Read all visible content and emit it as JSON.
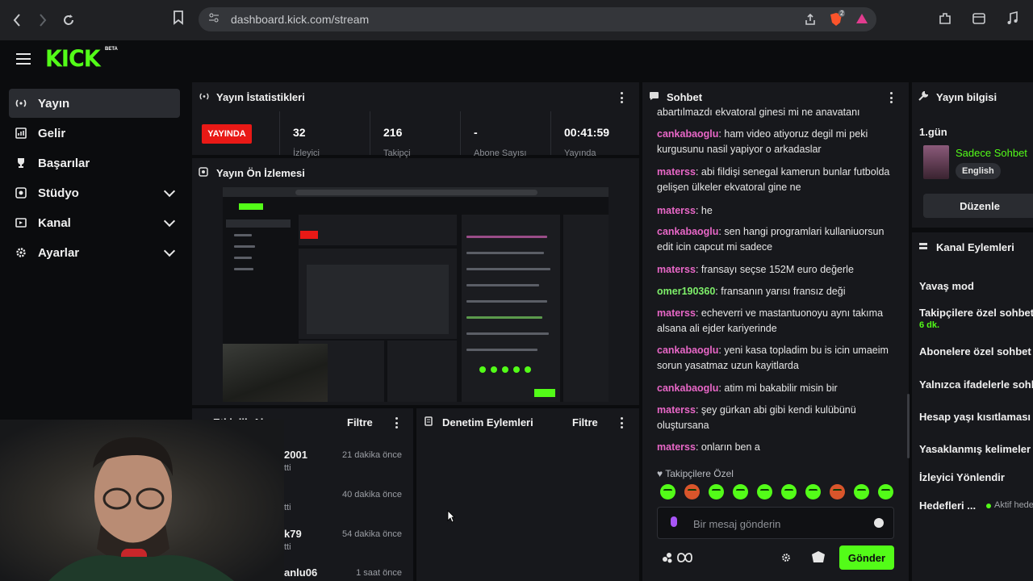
{
  "browser": {
    "url": "dashboard.kick.com/stream",
    "ext_badge": "2"
  },
  "brand": {
    "logo": "KICK",
    "beta": "BETA",
    "accent": "#53fc18"
  },
  "sidebar": {
    "items": [
      {
        "label": "Yayın",
        "icon": "broadcast-icon",
        "active": true
      },
      {
        "label": "Gelir",
        "icon": "revenue-icon"
      },
      {
        "label": "Başarılar",
        "icon": "trophy-icon"
      },
      {
        "label": "Stüdyo",
        "icon": "studio-icon",
        "expandable": true
      },
      {
        "label": "Kanal",
        "icon": "channel-icon",
        "expandable": true
      },
      {
        "label": "Ayarlar",
        "icon": "gear-icon",
        "expandable": true
      }
    ]
  },
  "stats": {
    "title": "Yayın İstatistikleri",
    "live": "YAYINDA",
    "columns": [
      {
        "value": "32",
        "label": "İzleyici"
      },
      {
        "value": "216",
        "label": "Takipçi"
      },
      {
        "value": "-",
        "label": "Abone Sayısı"
      },
      {
        "value": "00:41:59",
        "label": "Yayında"
      }
    ]
  },
  "preview": {
    "title": "Yayın Ön İzlemesi"
  },
  "activity": {
    "title": "Etkinlik Akışı",
    "filter": "Filtre",
    "rows": [
      {
        "name": "2001",
        "sub": "tti",
        "time": "21 dakika önce"
      },
      {
        "name": "",
        "sub": "tti",
        "time": "40 dakika önce"
      },
      {
        "name": "k79",
        "sub": "tti",
        "time": "54 dakika önce"
      },
      {
        "name": "anlu06",
        "sub": "",
        "time": "1 saat önce"
      }
    ]
  },
  "moderation": {
    "title": "Denetim Eylemleri",
    "filter": "Filtre"
  },
  "chat": {
    "title": "Sohbet",
    "messages": [
      {
        "user": "",
        "color": "#e6e6e6",
        "text": "abartılmazdı ekvatoral ginesi mi ne anavatanı"
      },
      {
        "user": "cankabaoglu",
        "color": "#e867c7",
        "text": "ham video atiyoruz degil mi peki kurgusunu nasil yapiyor o arkadaslar"
      },
      {
        "user": "materss",
        "color": "#e867c7",
        "text": "abi fildişi senegal kamerun bunlar futbolda gelişen ülkeler ekvatoral gine ne"
      },
      {
        "user": "materss",
        "color": "#e867c7",
        "text": "he"
      },
      {
        "user": "cankabaoglu",
        "color": "#e867c7",
        "text": "sen hangi programlari kullaniuorsun edit icin capcut mi sadece"
      },
      {
        "user": "materss",
        "color": "#e867c7",
        "text": "fransayı seçse 152M euro değerle"
      },
      {
        "user": "omer190360",
        "color": "#7ef06a",
        "text": "fransanın yarısı fransız deği"
      },
      {
        "user": "materss",
        "color": "#e867c7",
        "text": "echeverri ve mastantuonoyu aynı takıma alsana ali ejder kariyerinde"
      },
      {
        "user": "cankabaoglu",
        "color": "#e867c7",
        "text": "yeni kasa topladim bu is icin umaeim sorun yasatmaz uzun kayitlarda"
      },
      {
        "user": "cankabaoglu",
        "color": "#e867c7",
        "text": "atim mi bakabilir misin bir"
      },
      {
        "user": "materss",
        "color": "#e867c7",
        "text": "şey gürkan abi gibi kendi kulübünü oluştursana"
      },
      {
        "user": "materss",
        "color": "#e867c7",
        "text": "onların ben a"
      }
    ],
    "emote_label": "Takipçilere Özel",
    "input_placeholder": "Bir mesaj gönderin",
    "send": "Gönder"
  },
  "info": {
    "title": "Yayın bilgisi",
    "day": "1.gün",
    "name": "Sadece Sohbet",
    "language": "English",
    "edit": "Düzenle"
  },
  "channel_actions": {
    "title": "Kanal Eylemleri",
    "items": [
      {
        "label": "Yavaş mod"
      },
      {
        "label": "Takipçilere özel sohbet",
        "sub": "6 dk."
      },
      {
        "label": "Abonelere özel sohbet"
      },
      {
        "label": "Yalnızca ifadelerle sohbet"
      },
      {
        "label": "Hesap yaşı kısıtlaması"
      },
      {
        "label": "Yasaklanmış kelimeler"
      },
      {
        "label": "İzleyici Yönlendir"
      },
      {
        "label": "Hedefleri ...",
        "sub": "Aktif hedef"
      }
    ]
  }
}
